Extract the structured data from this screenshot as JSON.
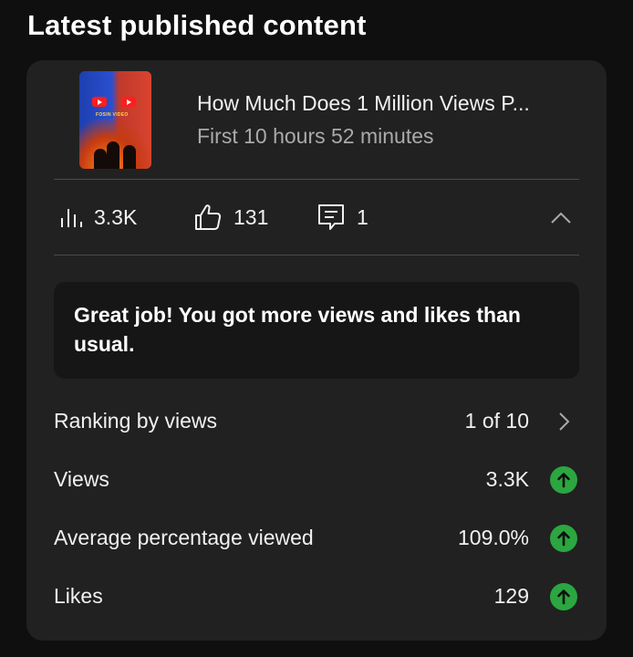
{
  "section": {
    "title": "Latest published content"
  },
  "video": {
    "title": "How Much Does 1 Million Views P...",
    "subtitle": "First 10 hours 52 minutes",
    "thumbnail_text": "FOSIN VIDEO"
  },
  "stats": {
    "views": "3.3K",
    "likes": "131",
    "comments": "1",
    "views_icon": "bar-chart-icon",
    "likes_icon": "thumbs-up-icon",
    "comments_icon": "comment-icon",
    "collapse_icon": "chevron-up-icon"
  },
  "banner": {
    "text": "Great job! You got more views and likes than usual."
  },
  "metrics": [
    {
      "label": "Ranking by views",
      "value": "1 of 10",
      "icon": "chevron-right-icon"
    },
    {
      "label": "Views",
      "value": "3.3K",
      "icon": "arrow-up-circle-icon"
    },
    {
      "label": "Average percentage viewed",
      "value": "109.0%",
      "icon": "arrow-up-circle-icon"
    },
    {
      "label": "Likes",
      "value": "129",
      "icon": "arrow-up-circle-icon"
    }
  ],
  "colors": {
    "background": "#0f0f0f",
    "card": "#212121",
    "banner": "#161616",
    "positive": "#2ba640",
    "secondary_text": "#aaaaaa"
  }
}
